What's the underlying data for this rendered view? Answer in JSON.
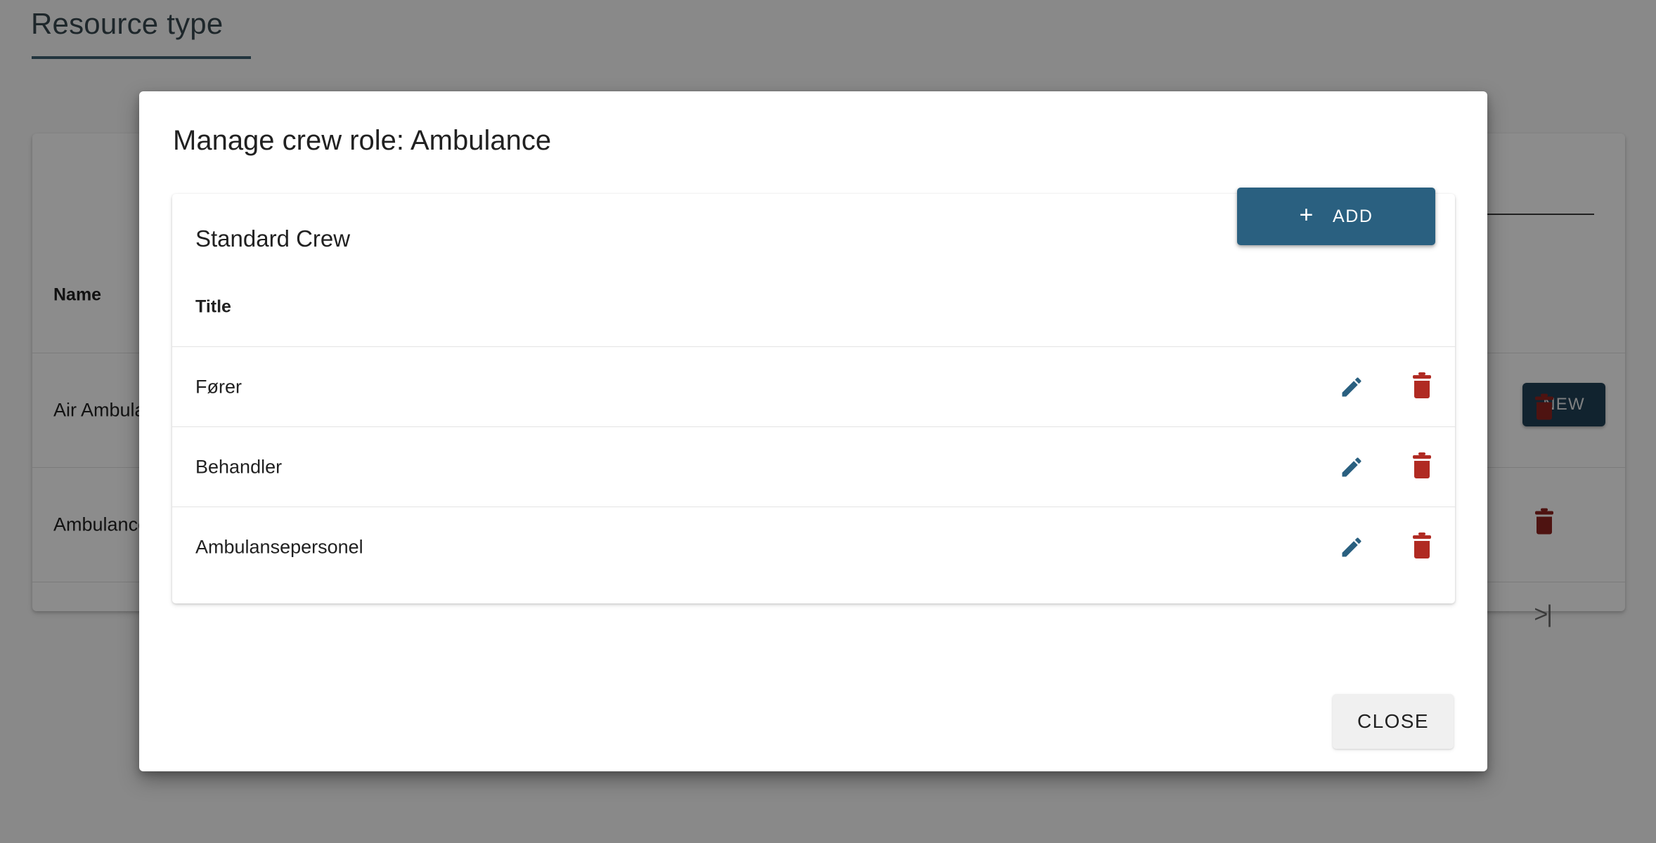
{
  "background": {
    "page_title": "Resource type",
    "new_button_label": "NEW",
    "table": {
      "columns": [
        "Name"
      ],
      "rows": [
        {
          "name": "Air Ambulance",
          "delete_icon": "trash-icon"
        },
        {
          "name": "Ambulance",
          "delete_icon": "trash-icon"
        }
      ]
    },
    "paginator": {
      "prev_label": "‹",
      "last_label": ">|"
    },
    "accent_color": "#3e6272",
    "new_button_color": "#1f4157",
    "delete_color": "#b02a22"
  },
  "dialog": {
    "title": "Manage crew role: Ambulance",
    "crew_name": "Standard Crew",
    "list": {
      "column_header": "Title",
      "add_button": {
        "label": "ADD",
        "icon": "plus-icon"
      },
      "rows": [
        {
          "title": "Fører",
          "edit_icon": "pencil-icon",
          "delete_icon": "trash-icon"
        },
        {
          "title": "Behandler",
          "edit_icon": "pencil-icon",
          "delete_icon": "trash-icon"
        },
        {
          "title": "Ambulansepersonel",
          "edit_icon": "pencil-icon",
          "delete_icon": "trash-icon"
        }
      ]
    },
    "close_button_label": "CLOSE",
    "primary_color": "#2a6080",
    "edit_color": "#2a6080",
    "delete_color": "#b02a22",
    "close_button_bg": "#f0f0f0"
  }
}
